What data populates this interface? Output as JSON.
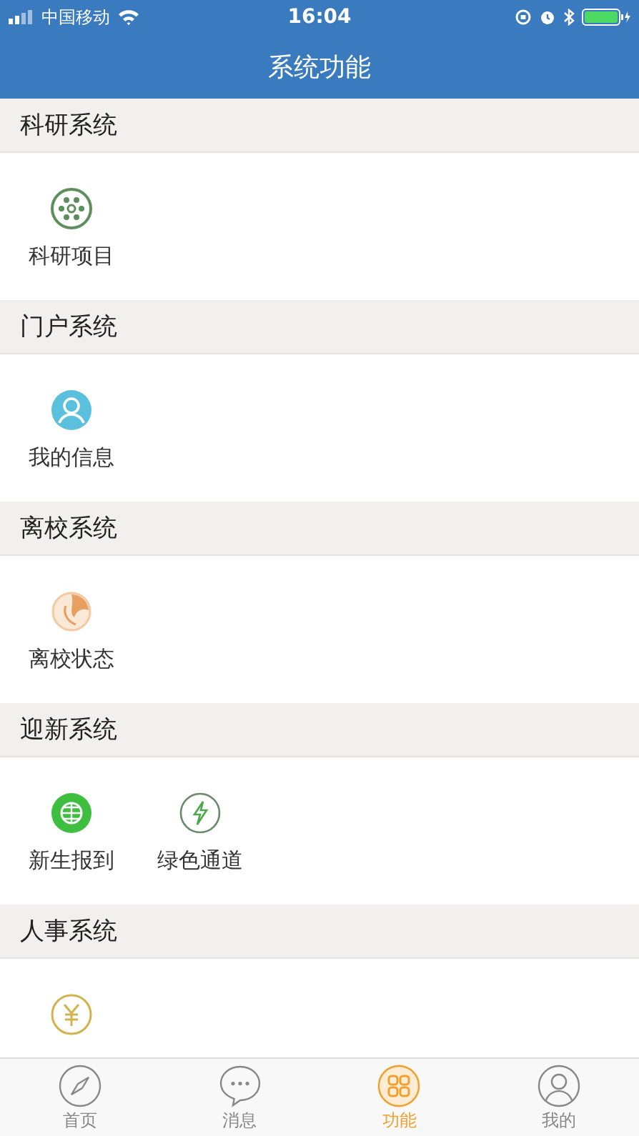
{
  "status_bar": {
    "carrier": "中国移动",
    "time": "16:04"
  },
  "nav": {
    "title": "系统功能"
  },
  "sections": [
    {
      "title": "科研系统",
      "items": [
        {
          "label": "科研项目",
          "kind": "atom"
        }
      ]
    },
    {
      "title": "门户系统",
      "items": [
        {
          "label": "我的信息",
          "kind": "user"
        }
      ]
    },
    {
      "title": "离校系统",
      "items": [
        {
          "label": "离校状态",
          "kind": "swirl"
        }
      ]
    },
    {
      "title": "迎新系统",
      "items": [
        {
          "label": "新生报到",
          "kind": "globe"
        },
        {
          "label": "绿色通道",
          "kind": "bolt"
        }
      ]
    },
    {
      "title": "人事系统",
      "items": [
        {
          "kind": "yen"
        }
      ]
    }
  ],
  "tabs": [
    {
      "label": "首页",
      "kind": "compass",
      "selected": false
    },
    {
      "label": "消息",
      "kind": "chat",
      "selected": false
    },
    {
      "label": "功能",
      "kind": "grid",
      "selected": true
    },
    {
      "label": "我的",
      "kind": "person",
      "selected": false
    }
  ]
}
